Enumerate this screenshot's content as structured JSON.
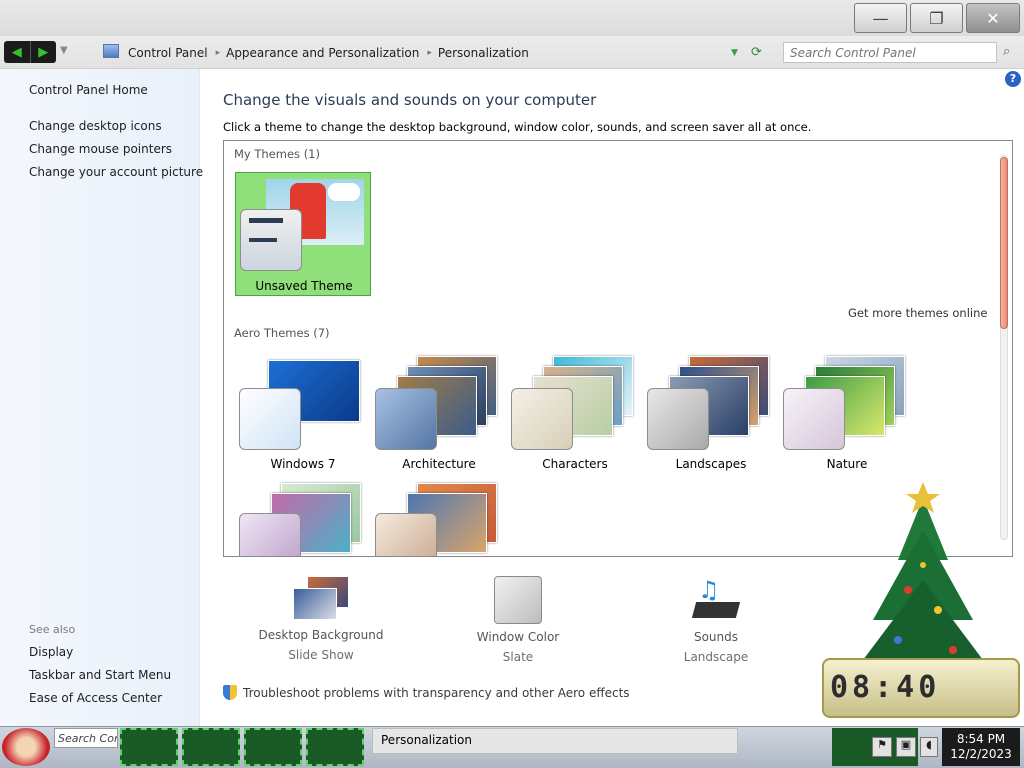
{
  "window": {
    "controls": {
      "minimize": "—",
      "maximize": "❐",
      "close": "✕"
    }
  },
  "nav": {
    "breadcrumbs": [
      "Control Panel",
      "Appearance and Personalization",
      "Personalization"
    ],
    "search_placeholder": "Search Control Panel"
  },
  "sidebar": {
    "home": "Control Panel Home",
    "tasks": [
      "Change desktop icons",
      "Change mouse pointers",
      "Change your account picture"
    ],
    "see_also_heading": "See also",
    "see_also": [
      "Display",
      "Taskbar and Start Menu",
      "Ease of Access Center"
    ]
  },
  "main": {
    "heading": "Change the visuals and sounds on your computer",
    "instructions": "Click a theme to change the desktop background, window color, sounds, and screen saver all at once.",
    "help_label": "?",
    "groups": {
      "my_themes": "My Themes (1)",
      "aero_themes": "Aero Themes (7)"
    },
    "get_more": "Get more themes online",
    "my_themes": [
      {
        "label": "Unsaved Theme",
        "selected": true
      }
    ],
    "aero_themes": [
      {
        "label": "Windows 7",
        "colors": [
          "#1565c8",
          "#0d4aa1"
        ]
      },
      {
        "label": "Architecture",
        "colors": [
          "#3a5d8a",
          "#a77a3d"
        ]
      },
      {
        "label": "Characters",
        "colors": [
          "#3fb8d6",
          "#c4d9b8"
        ]
      },
      {
        "label": "Landscapes",
        "colors": [
          "#304a7c",
          "#c8a070"
        ]
      },
      {
        "label": "Nature",
        "colors": [
          "#2f8d3a",
          "#a6d24f"
        ]
      },
      {
        "label": "",
        "colors": [
          "#8a5fb6",
          "#d6c3e7"
        ]
      },
      {
        "label": "",
        "colors": [
          "#c8763b",
          "#4c6e9c"
        ]
      }
    ],
    "bottom": [
      {
        "title": "Desktop Background",
        "sub": "Slide Show"
      },
      {
        "title": "Window Color",
        "sub": "Slate"
      },
      {
        "title": "Sounds",
        "sub": "Landscape"
      }
    ],
    "troubleshoot": "Troubleshoot problems with transparency and other Aero effects"
  },
  "taskbar": {
    "search_text": "Search Con",
    "active_window": "Personalization",
    "time": "8:54 PM",
    "date": "12/2/2023"
  }
}
